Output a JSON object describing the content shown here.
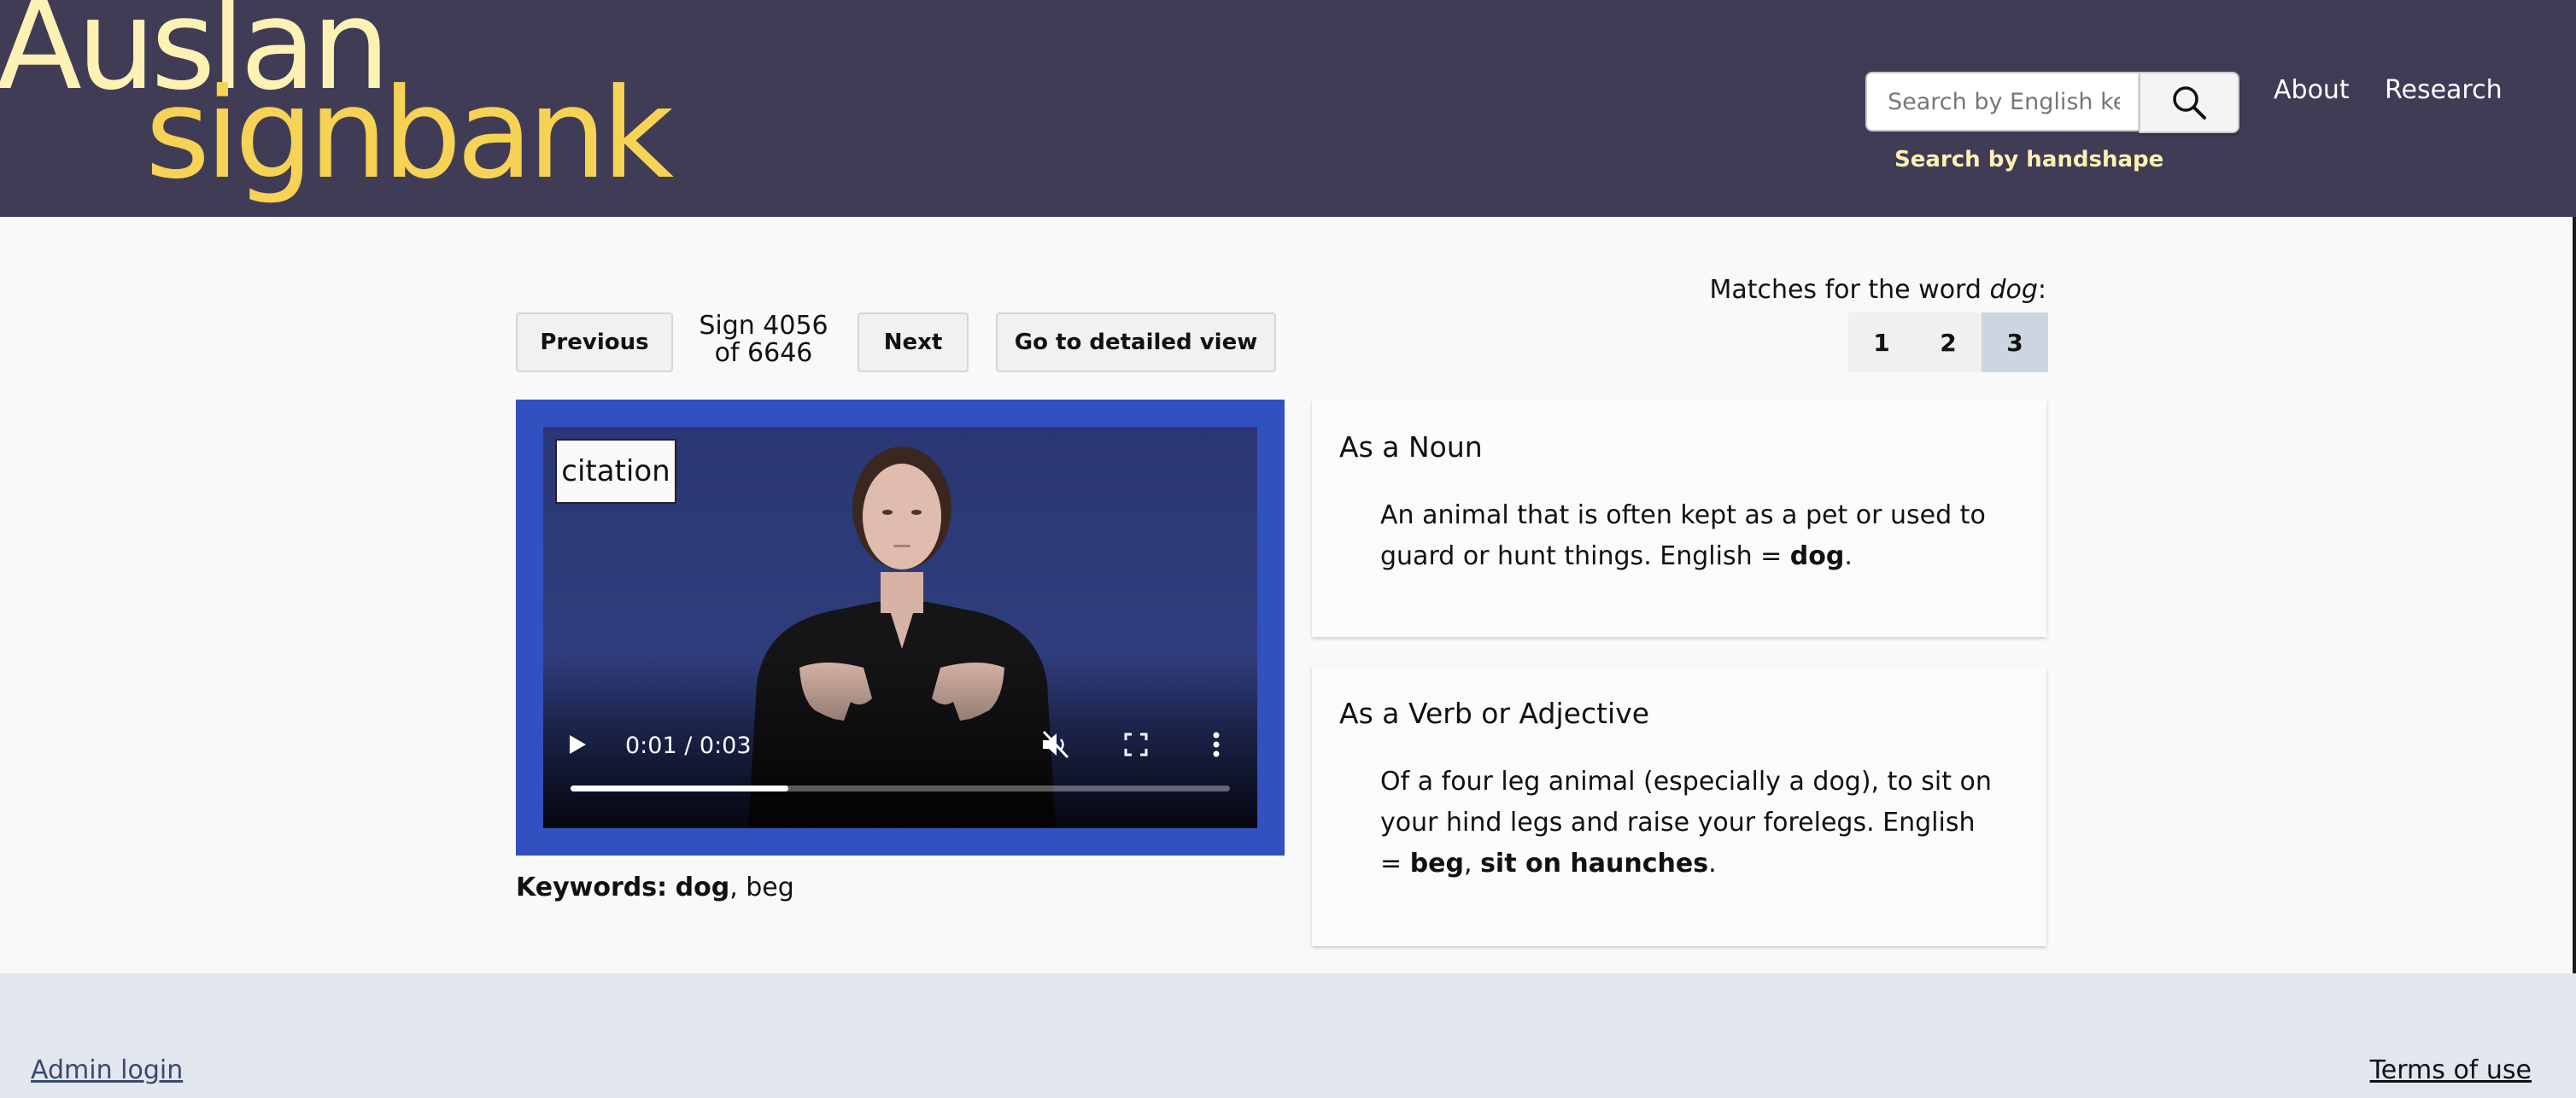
{
  "header": {
    "logo_top": "Auslan",
    "logo_bottom": "signbank",
    "search_placeholder": "Search by English keyword",
    "search_handshape": "Search by handshape",
    "nav": [
      {
        "label": "About"
      },
      {
        "label": "Research"
      }
    ],
    "colors": {
      "bg": "#413c56",
      "logo_light": "#fdf1b3",
      "logo_yellow": "#f6d255"
    }
  },
  "toolbar": {
    "previous_label": "Previous",
    "sign_line1": "Sign 4056",
    "sign_line2": "of 6646",
    "next_label": "Next",
    "detailed_label": "Go to detailed view"
  },
  "matches": {
    "label_prefix": "Matches for the word ",
    "word": "dog",
    "label_suffix": ":",
    "pages": [
      "1",
      "2",
      "3"
    ],
    "active_page": "3"
  },
  "video": {
    "tag": "citation",
    "time": "0:01 / 0:03",
    "progress_fraction": 0.33,
    "icons": [
      "play-icon",
      "mute-icon",
      "fullscreen-icon",
      "more-options-icon"
    ],
    "frame_color": "#3350c0"
  },
  "keywords": {
    "label": "Keywords:",
    "primary": "dog",
    "rest": ", beg"
  },
  "definitions": [
    {
      "title": "As a Noun",
      "text": "An animal that is often kept as a pet or used to guard or hunt things. English = ",
      "bold": "dog",
      "end": "."
    },
    {
      "title": "As a Verb or Adjective",
      "text": "Of a four leg animal (especially a dog), to sit on your hind legs and raise your forelegs. English = ",
      "bold": "beg",
      "sep": ", ",
      "bold2": "sit on haunches",
      "end": "."
    }
  ],
  "footer": {
    "admin_login": "Admin login",
    "terms": "Terms of use"
  }
}
